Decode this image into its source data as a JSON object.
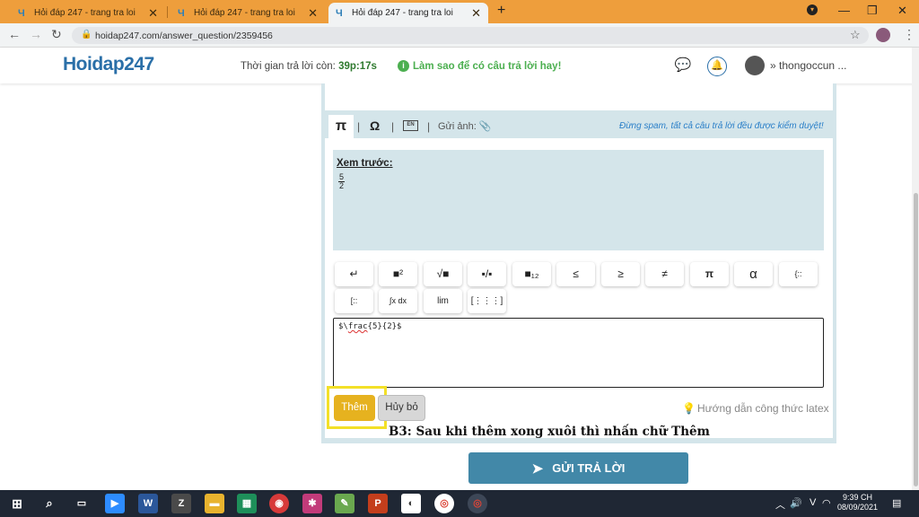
{
  "browser": {
    "tabs": [
      {
        "title": "Hỏi đáp 247 - trang tra loi",
        "active": false
      },
      {
        "title": "Hỏi đáp 247 - trang tra loi",
        "active": false
      },
      {
        "title": "Hỏi đáp 247 - trang tra loi",
        "active": true
      }
    ],
    "new_tab": "+",
    "url": "hoidap247.com/answer_question/2359456"
  },
  "header": {
    "logo": "Hoidap247",
    "timer_label": "Thời gian trả lời còn:",
    "timer_value": "39p:17s",
    "tip": "Làm sao để có câu trả lời hay!",
    "username": "thongoccun ..."
  },
  "editor": {
    "toolbar": {
      "pi": "π",
      "omega": "Ω",
      "en": "EN",
      "upload_label": "Gửi ảnh:"
    },
    "spam_warning": "Đừng spam, tất cả câu trả lời đều được kiểm duyệt!",
    "preview_label": "Xem trước:",
    "preview_numerator": "5",
    "preview_denominator": "2",
    "keys": [
      "↵",
      "■²",
      "√■",
      "▪/▪",
      "■₁₂",
      "≤",
      "≥",
      "≠",
      "π",
      "α",
      "{::",
      "[::",
      "∫x dx",
      "lim",
      "[⋮⋮⋮]"
    ],
    "input_prefix": "$\\",
    "input_cmd": "frac",
    "input_suffix": "{5}{2}$",
    "add_label": "Thêm",
    "cancel_label": "Hủy bỏ",
    "guide_label": "Hướng dẫn công thức latex"
  },
  "caption": "B3: Sau khi thêm xong xuôi thì nhấn chữ Thêm",
  "send_label": "GỬI TRẢ LỜI",
  "taskbar": {
    "time": "9:39 CH",
    "date": "08/09/2021",
    "lang": "V"
  },
  "colors": {
    "tabbar": "#ee9e3c",
    "panel": "#d4e5ea",
    "add": "#e6b21f",
    "send": "#4288a8",
    "highlight": "#f3e028"
  }
}
